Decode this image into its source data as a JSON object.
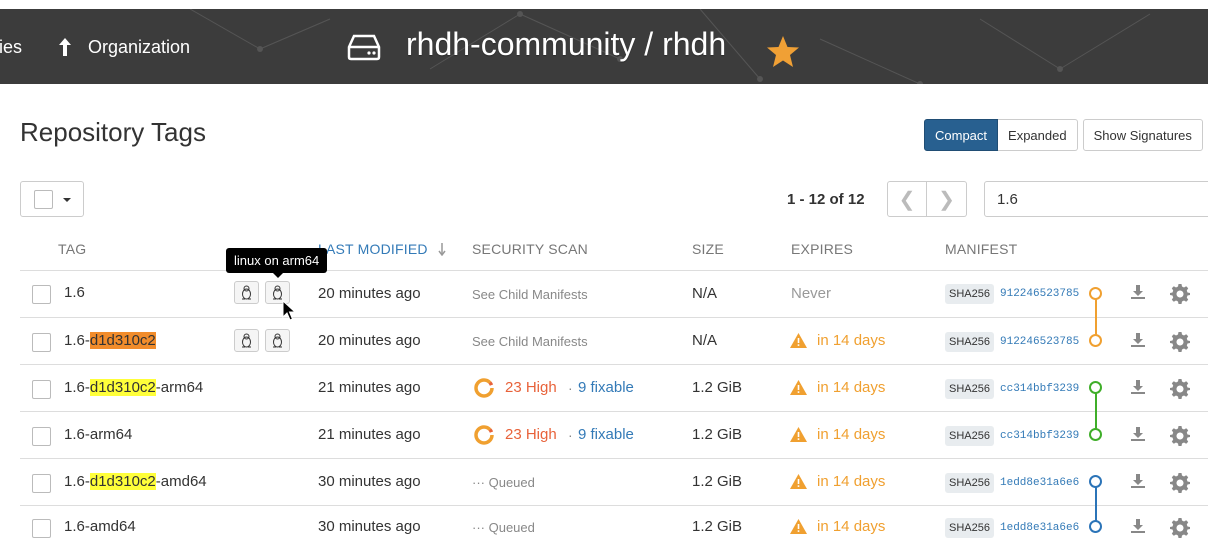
{
  "header": {
    "breadcrumb_repos": "tories",
    "org_label": "Organization",
    "repo_title": "rhdh-community / rhdh"
  },
  "page": {
    "title": "Repository Tags",
    "view_compact": "Compact",
    "view_expanded": "Expanded",
    "show_signatures": "Show Signatures"
  },
  "toolbar": {
    "page_count": "1 - 12 of 12",
    "pager_prev": "❮",
    "pager_next": "❯",
    "filter_value": "1.6"
  },
  "columns": {
    "tag": "TAG",
    "last_modified": "LAST MODIFIED",
    "security_scan": "SECURITY SCAN",
    "size": "SIZE",
    "expires": "EXPIRES",
    "manifest": "MANIFEST"
  },
  "tooltip": "linux on arm64",
  "rows": [
    {
      "tag_prefix": "1.6",
      "tag_hl": "",
      "tag_suffix": "",
      "modified": "20 minutes ago",
      "scan": "See Child Manifests",
      "size": "N/A",
      "expires": "Never",
      "sha": "SHA256",
      "digest": "912246523785"
    },
    {
      "tag_prefix": "1.6-",
      "tag_hl": "d1d310c2",
      "tag_suffix": "",
      "modified": "20 minutes ago",
      "scan": "See Child Manifests",
      "size": "N/A",
      "expires": "in 14 days",
      "sha": "SHA256",
      "digest": "912246523785"
    },
    {
      "tag_prefix": "1.6-",
      "tag_hl": "d1d310c2",
      "tag_suffix": "-arm64",
      "modified": "21 minutes ago",
      "scan_high": "23 High",
      "scan_dot": "·",
      "scan_fix": "9 fixable",
      "size": "1.2 GiB",
      "expires": "in 14 days",
      "sha": "SHA256",
      "digest": "cc314bbf3239"
    },
    {
      "tag_prefix": "1.6-arm64",
      "tag_hl": "",
      "tag_suffix": "",
      "modified": "21 minutes ago",
      "scan_high": "23 High",
      "scan_dot": "·",
      "scan_fix": "9 fixable",
      "size": "1.2 GiB",
      "expires": "in 14 days",
      "sha": "SHA256",
      "digest": "cc314bbf3239"
    },
    {
      "tag_prefix": "1.6-",
      "tag_hl": "d1d310c2",
      "tag_suffix": "-amd64",
      "modified": "30 minutes ago",
      "scan": "··· Queued",
      "size": "1.2 GiB",
      "expires": "in 14 days",
      "sha": "SHA256",
      "digest": "1edd8e31a6e6"
    },
    {
      "tag_prefix": "1.6-amd64",
      "tag_hl": "",
      "tag_suffix": "",
      "modified": "30 minutes ago",
      "scan": "··· Queued",
      "size": "1.2 GiB",
      "expires": "in 14 days",
      "sha": "SHA256",
      "digest": "1edd8e31a6e6"
    }
  ],
  "colors": {
    "manifest_orange": "#f0a030",
    "manifest_green": "#3fae29",
    "manifest_blue": "#2b74b8"
  }
}
